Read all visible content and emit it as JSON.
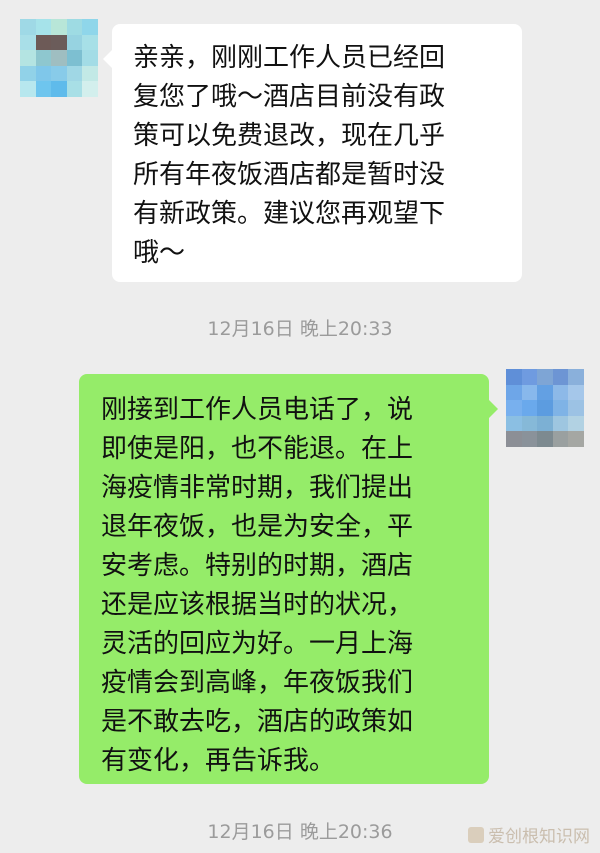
{
  "messages": [
    {
      "side": "left",
      "text": "亲亲，刚刚工作人员已经回\n复您了哦～酒店目前没有政\n策可以免费退改，现在几乎\n所有年夜饭酒店都是暂时没\n有新政策。建议您再观望下\n哦～"
    },
    {
      "side": "right",
      "text": "刚接到工作人员电话了，说\n即使是阳，也不能退。在上\n海疫情非常时期，我们提出\n退年夜饭，也是为安全，平\n安考虑。特别的时期，酒店\n还是应该根据当时的状况，\n灵活的回应为好。一月上海\n疫情会到高峰，年夜饭我们\n是不敢去吃，酒店的政策如\n有变化，再告诉我。"
    }
  ],
  "timestamps": [
    "12月16日 晚上20:33",
    "12月16日 晚上20:36"
  ],
  "watermark": "爱创根知识网",
  "avatars": {
    "left_colors": [
      "#9fd9e6",
      "#a6e3ea",
      "#b8e6d8",
      "#9edbe3",
      "#8fd6ea",
      "#a9dfe8",
      "#6d5a57",
      "#6b5c5a",
      "#97d3e1",
      "#a7e0e7",
      "#b4e4e2",
      "#8ec7cf",
      "#9fbec1",
      "#7dbfd1",
      "#a3dce6",
      "#91d2e8",
      "#7fc7ea",
      "#88cbe9",
      "#a0d7e5",
      "#c2e9e6",
      "#b7e7ee",
      "#6ec5ee",
      "#5fbbeb",
      "#a8dfe6",
      "#d3efed"
    ],
    "right_colors": [
      "#5f8fd8",
      "#6f9be0",
      "#7ea5d5",
      "#6d95d4",
      "#8ab0db",
      "#6ea6e8",
      "#88b8ec",
      "#63a0e3",
      "#8db9e8",
      "#a5c7ea",
      "#78b0ee",
      "#6aa9ec",
      "#5c9ce0",
      "#7fb3e6",
      "#9cc2e4",
      "#8bbfe3",
      "#86b9d8",
      "#7cb0d4",
      "#9ec6e0",
      "#b2d2e3",
      "#8c8f96",
      "#8a929a",
      "#7d8a90",
      "#9aa0a0",
      "#a5a7a3"
    ]
  }
}
